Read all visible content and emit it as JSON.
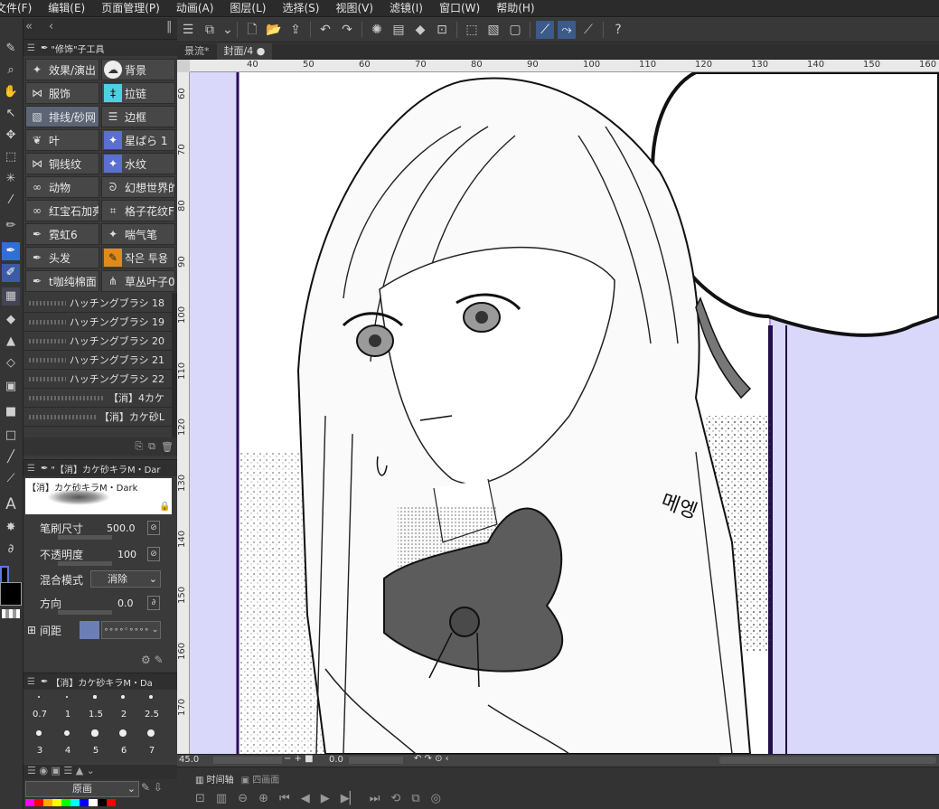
{
  "menu": [
    "文件(F)",
    "编辑(E)",
    "页面管理(P)",
    "动画(A)",
    "图层(L)",
    "选择(S)",
    "视图(V)",
    "滤镜(I)",
    "窗口(W)",
    "帮助(H)"
  ],
  "subtool_panel": {
    "title": "\"修饰\"子工具",
    "groups": [
      {
        "label": "效果/演出",
        "icon": "sparkle-icon"
      },
      {
        "label": "背景",
        "icon": "cloud-icon"
      },
      {
        "label": "服饰",
        "icon": "bow-icon"
      },
      {
        "label": "拉链",
        "icon": "zipper-icon"
      },
      {
        "label": "排线/砂网",
        "icon": "hatch-icon",
        "selected": true
      },
      {
        "label": "边框",
        "icon": "border-icon"
      },
      {
        "label": "叶",
        "icon": "leaf-icon"
      },
      {
        "label": "星ぱら 1",
        "icon": "star-icon"
      },
      {
        "label": "铜线纹",
        "icon": "bow-icon"
      },
      {
        "label": "水纹",
        "icon": "star-icon"
      },
      {
        "label": "动物",
        "icon": "chain-icon"
      },
      {
        "label": "幻想世界的",
        "icon": "swirl-icon"
      },
      {
        "label": "红宝石加亮",
        "icon": "chain-icon"
      },
      {
        "label": "格子花纹F",
        "icon": "grid-icon"
      },
      {
        "label": "霓虹6",
        "icon": "pen-icon"
      },
      {
        "label": "喘气笔",
        "icon": "sparkle-icon"
      },
      {
        "label": "头发",
        "icon": "pen-icon"
      },
      {
        "label": "작은 투용",
        "icon": "orange-pen-icon"
      },
      {
        "label": "t咖纯棉面",
        "icon": "pen-icon"
      },
      {
        "label": "草丛叶子0",
        "icon": "grass-icon"
      }
    ],
    "brushes": [
      "ハッチングブラシ 18",
      "ハッチングブラシ 19",
      "ハッチングブラシ 20",
      "ハッチングブラシ 21",
      "ハッチングブラシ 22",
      "【消】4カケ",
      "【消】カケ砂L"
    ]
  },
  "tool_property": {
    "header": "\"【消】カケ砂キラM・Dar",
    "preview_name": "【消】カケ砂キラM・Dark",
    "brush_size_label": "笔刷尺寸",
    "brush_size_value": "500.0",
    "opacity_label": "不透明度",
    "opacity_value": "100",
    "blend_label": "混合模式",
    "blend_value": "消除",
    "direction_label": "方向",
    "direction_value": "0.0",
    "spacing_label": "间距"
  },
  "brush_size_panel": {
    "header": "【消】カケ砂キラM・Da",
    "sizes": [
      "0.7",
      "1",
      "1.5",
      "2",
      "2.5",
      "3",
      "4",
      "5",
      "6",
      "7"
    ]
  },
  "layer_dropdown": "原画",
  "tabs": [
    {
      "label": "景流*",
      "active": false
    },
    {
      "label": "封面/4",
      "active": true
    }
  ],
  "ruler_top": [
    "40",
    "50",
    "60",
    "70",
    "80",
    "90",
    "100",
    "110",
    "120",
    "130",
    "140",
    "150",
    "160"
  ],
  "ruler_left": [
    "60",
    "70",
    "80",
    "90",
    "100",
    "110",
    "120",
    "130",
    "140",
    "150",
    "160",
    "170"
  ],
  "status": {
    "zoom": "45.0",
    "angle": "0.0"
  },
  "timeline": {
    "tab1": "时间轴",
    "tab2": "四画面"
  },
  "sfx_text": "메엥"
}
